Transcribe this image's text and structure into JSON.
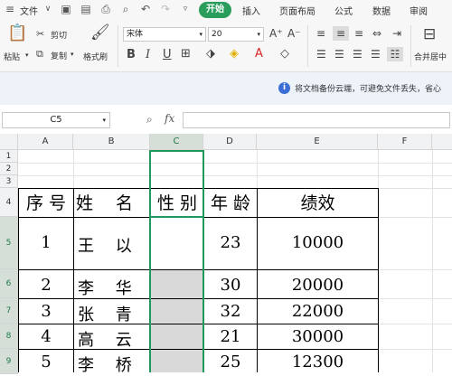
{
  "menubar": {
    "file_label": "文件",
    "start_label": "开始",
    "tabs": [
      "插入",
      "页面布局",
      "公式",
      "数据",
      "审阅"
    ]
  },
  "ribbon": {
    "paste_label": "粘贴",
    "cut_label": "剪切",
    "copy_label": "复制",
    "format_painter_label": "格式刷",
    "font_name": "宋体",
    "font_size": "20",
    "bold": "B",
    "italic": "I",
    "underline": "U",
    "merge_label": "合并居中"
  },
  "notice": {
    "text": "将文档备份云端，可避免文件丢失，省心"
  },
  "formula_bar": {
    "name_box": "C5",
    "fx": "fx"
  },
  "sheet": {
    "columns": [
      "A",
      "B",
      "C",
      "D",
      "E",
      "F"
    ],
    "rows": [
      "1",
      "2",
      "3",
      "4",
      "5",
      "6",
      "7",
      "8",
      "9"
    ],
    "header": {
      "seq": "序 号",
      "name": "姓　 名",
      "gender": "性 别",
      "age": "年 龄",
      "perf": "绩效"
    },
    "data": [
      {
        "seq": "1",
        "name": "王　 以",
        "age": "23",
        "perf": "10000"
      },
      {
        "seq": "2",
        "name": "李　 华",
        "age": "30",
        "perf": "20000"
      },
      {
        "seq": "3",
        "name": "张　 青",
        "age": "32",
        "perf": "22000"
      },
      {
        "seq": "4",
        "name": "高　 云",
        "age": "21",
        "perf": "30000"
      },
      {
        "seq": "5",
        "name": "李　 桥",
        "age": "25",
        "perf": "12300"
      }
    ]
  },
  "colors": {
    "accent": "#2a9d5c",
    "selection": "#1f9a5c",
    "fill_gray": "#d9d9d9"
  }
}
